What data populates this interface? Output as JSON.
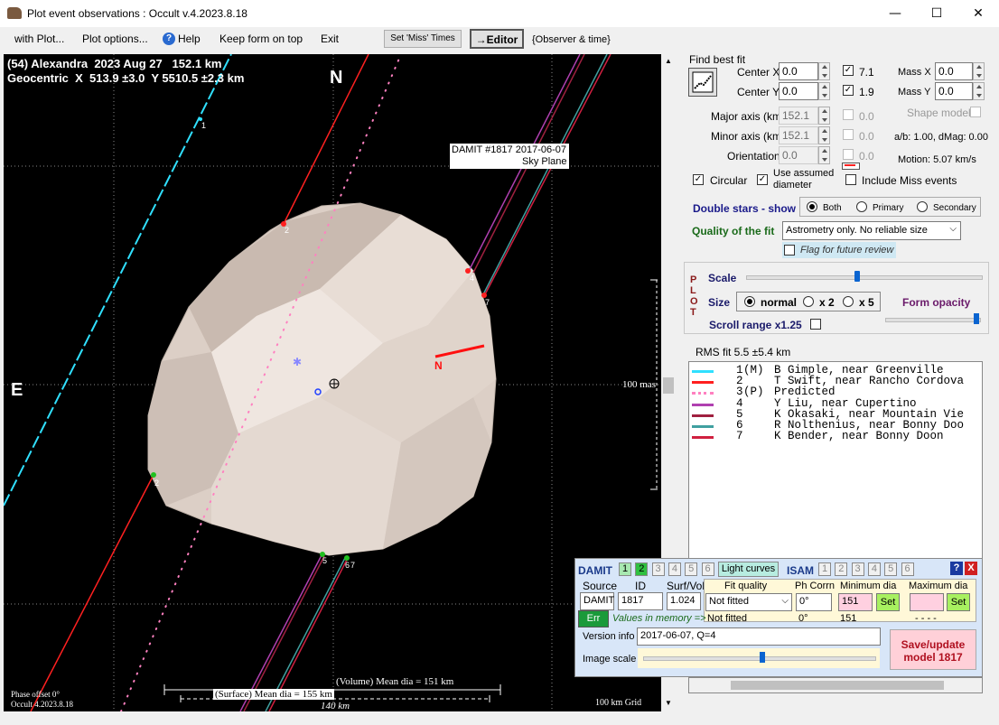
{
  "window": {
    "title": "Plot event observations : Occult v.4.2023.8.18",
    "min": "—",
    "max": "☐",
    "close": "✕"
  },
  "menu": {
    "with_plot": "with Plot...",
    "plot_options": "Plot options...",
    "help": "Help",
    "keep_form": "Keep form on top",
    "exit": "Exit",
    "set_miss": "Set 'Miss' Times",
    "editor": "→Editor",
    "observer": "{Observer & time}"
  },
  "plot": {
    "header1": "(54) Alexandra  2023 Aug 27   152.1 km",
    "header2": "Geocentric  X  513.9 ±3.0  Y 5510.5 ±2.3 km",
    "north": "N",
    "east": "E",
    "n_arrow": "N",
    "damit_label1": "DAMIT #1817 2017-06-07",
    "damit_label2": "Sky Plane",
    "scale_label": "100 mas",
    "vol_dia": "(Volume) Mean dia = 151 km",
    "surf_dia": "(Surface) Mean dia = 155 km",
    "km140": "140 km",
    "phase": "Phase offset 0°",
    "version": "Occult 4.2023.8.18",
    "grid": "100 km Grid",
    "chord_labels": [
      "1",
      "2",
      "2",
      "4",
      "5",
      "6",
      "7",
      "5",
      "6",
      "7"
    ]
  },
  "fit": {
    "title": "Find best fit",
    "center_x_label": "Center X",
    "center_x": "0.0",
    "cx_check": "7.1",
    "center_y_label": "Center Y",
    "center_y": "0.0",
    "cy_check": "1.9",
    "mass_x_label": "Mass X",
    "mass_x": "0.0",
    "mass_y_label": "Mass Y",
    "mass_y": "0.0",
    "major_label": "Major axis (km)",
    "major": "152.1",
    "major_chk": "0.0",
    "minor_label": "Minor axis (km)",
    "minor": "152.1",
    "minor_chk": "0.0",
    "orient_label": "Orientation",
    "orient": "0.0",
    "orient_chk": "0.0",
    "shape_model": "Shape model",
    "ab": "a/b: 1.00, dMag: 0.00",
    "motion": "Motion: 5.07 km/s",
    "circular": "Circular",
    "use_assumed": "Use assumed",
    "diameter": "diameter",
    "include_miss": "Include Miss events"
  },
  "double_stars": {
    "label": "Double stars - show",
    "both": "Both",
    "primary": "Primary",
    "secondary": "Secondary"
  },
  "quality": {
    "label": "Quality of the fit",
    "value": "Astrometry only. No reliable size",
    "flag": "Flag for future review"
  },
  "plotbox": {
    "plot_v": "PLOT",
    "scale": "Scale",
    "size": "Size",
    "normal": "normal",
    "x2": "x 2",
    "x5": "x 5",
    "form_opacity": "Form opacity",
    "scroll_range": "Scroll range x1.25"
  },
  "rms": "RMS fit 5.5 ±5.4 km",
  "legend": [
    {
      "n": "1",
      "flag": "(M)",
      "name": "B Gimple, near Greenville",
      "color": "#30e0ff",
      "style": "solid"
    },
    {
      "n": "2",
      "flag": "",
      "name": "T Swift, near Rancho Cordova",
      "color": "#ff2020",
      "style": "solid"
    },
    {
      "n": "3",
      "flag": "(P)",
      "name": "Predicted",
      "color": "#ff80c0",
      "style": "dots"
    },
    {
      "n": "4",
      "flag": "",
      "name": "Y Liu, near Cupertino",
      "color": "#b040b0",
      "style": "solid"
    },
    {
      "n": "5",
      "flag": "",
      "name": "K Okasaki, near Mountain Vie",
      "color": "#a02040",
      "style": "solid"
    },
    {
      "n": "6",
      "flag": "",
      "name": "R Nolthenius, near Bonny Doo",
      "color": "#40a0a0",
      "style": "solid"
    },
    {
      "n": "7",
      "flag": "",
      "name": "K Bender, near Bonny Doon",
      "color": "#d02040",
      "style": "solid"
    }
  ],
  "damit": {
    "damit": "DAMIT",
    "tabs_damit": [
      "1",
      "2",
      "3",
      "4",
      "5",
      "6"
    ],
    "light_curves": "Light curves",
    "isam": "ISAM",
    "tabs_isam": [
      "1",
      "2",
      "3",
      "4",
      "5",
      "6"
    ],
    "help": "?",
    "close": "X",
    "source_h": "Source",
    "id_h": "ID",
    "surfvol_h": "Surf/Vol",
    "source": "DAMIT",
    "id": "1817",
    "surfvol": "1.024",
    "fit_quality_h": "Fit quality",
    "phcorr_h": "Ph Corrn",
    "min_dia_h": "Minimum dia",
    "max_dia_h": "Maximum dia",
    "fit_quality": "Not fitted",
    "phcorr": "0°",
    "min_dia": "151",
    "set": "Set",
    "err": "Err",
    "values_mem": "Values in memory =>",
    "mem_fit": "Not fitted",
    "mem_ph": "0°",
    "mem_min": "151",
    "mem_max": "- - - -",
    "version_label": "Version info",
    "version_value": "2017-06-07, Q=4",
    "image_scale": "Image scale",
    "save": "Save/update",
    "save2": "model 1817"
  }
}
